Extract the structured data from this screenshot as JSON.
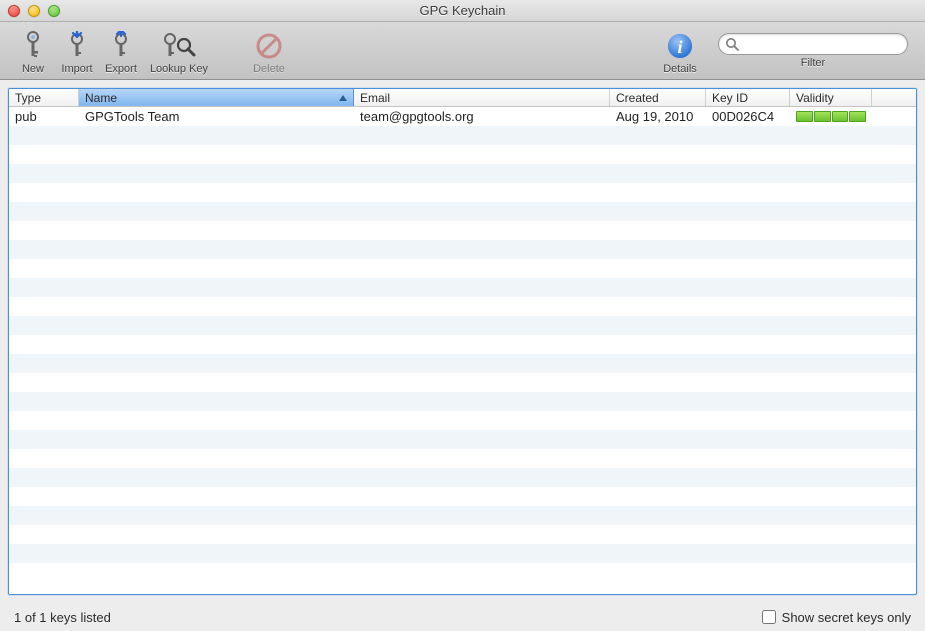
{
  "window": {
    "title": "GPG Keychain"
  },
  "toolbar": {
    "new": "New",
    "import": "Import",
    "export": "Export",
    "lookup": "Lookup Key",
    "delete": "Delete",
    "details": "Details",
    "filter": "Filter",
    "search_placeholder": ""
  },
  "table": {
    "columns": {
      "type": "Type",
      "name": "Name",
      "email": "Email",
      "created": "Created",
      "keyid": "Key ID",
      "validity": "Validity"
    },
    "sorted_column": "name",
    "rows": [
      {
        "type": "pub",
        "name": "GPGTools Team",
        "email": "team@gpgtools.org",
        "created": "Aug 19, 2010",
        "keyid": "00D026C4",
        "validity_level": 4
      }
    ]
  },
  "status": {
    "count_text": "1 of 1 keys listed",
    "secret_checkbox_label": "Show secret keys only",
    "secret_checked": false
  },
  "icons": {
    "key_new": "key-new-icon",
    "key_import": "key-import-icon",
    "key_export": "key-export-icon",
    "key_lookup": "key-lookup-icon",
    "delete": "prohibit-icon",
    "info": "info-icon",
    "search": "search-icon"
  }
}
